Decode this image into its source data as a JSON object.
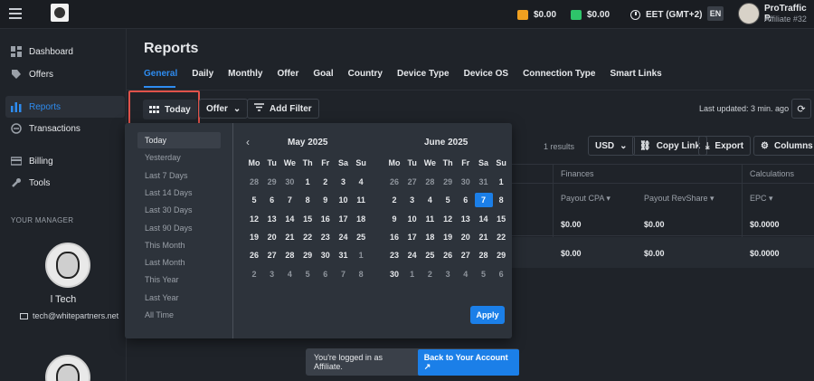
{
  "topbar": {
    "balance1": "$0.00",
    "balance2": "$0.00",
    "timezone": "EET (GMT+2)",
    "lang": "EN",
    "user_name": "ProTraffic P.",
    "user_role": "Affiliate #32",
    "balance1_color": "#f0a020",
    "balance2_color": "#2ec46a"
  },
  "sidebar": {
    "items": [
      {
        "label": "Dashboard",
        "icon": "dashboard-icon"
      },
      {
        "label": "Offers",
        "icon": "tag-icon"
      },
      {
        "label": "Reports",
        "icon": "bar-chart-icon"
      },
      {
        "label": "Transactions",
        "icon": "transactions-icon"
      },
      {
        "label": "Billing",
        "icon": "card-icon"
      },
      {
        "label": "Tools",
        "icon": "wrench-icon"
      }
    ],
    "manager_section": "YOUR MANAGER",
    "manager_name": "l Tech",
    "manager_email": "tech@whitepartners.net",
    "accent": "#2e8cf0"
  },
  "page": {
    "title": "Reports",
    "tabs": [
      "General",
      "Daily",
      "Monthly",
      "Offer",
      "Goal",
      "Country",
      "Device Type",
      "Device OS",
      "Connection Type",
      "Smart Links"
    ],
    "today_btn": "Today",
    "offer_btn": "Offer",
    "add_filter_btn": "Add Filter",
    "last_updated": "Last updated: 3 min. ago",
    "results": "1 results",
    "currency": "USD",
    "copy_link": "Copy Link",
    "export": "Export",
    "columns": "Columns"
  },
  "table": {
    "group_finances": "Finances",
    "group_calculations": "Calculations",
    "col_payout_cpa": "Payout CPA ▾",
    "col_payout_revshare": "Payout RevShare ▾",
    "col_epc": "EPC ▾",
    "rows": [
      {
        "payout_cpa": "$0.00",
        "payout_revshare": "$0.00",
        "epc": "$0.0000"
      },
      {
        "payout_cpa": "$0.00",
        "payout_revshare": "$0.00",
        "epc": "$0.0000"
      }
    ]
  },
  "datepicker": {
    "ranges": [
      "Today",
      "Yesterday",
      "Last 7 Days",
      "Last 14 Days",
      "Last 30 Days",
      "Last 90 Days",
      "This Month",
      "Last Month",
      "This Year",
      "Last Year",
      "All Time"
    ],
    "active_range": "Today",
    "weekdays": [
      "Mo",
      "Tu",
      "We",
      "Th",
      "Fr",
      "Sa",
      "Su"
    ],
    "months": [
      {
        "title": "May 2025",
        "weeks": [
          [
            "28",
            "29",
            "30",
            "1",
            "2",
            "3",
            "4"
          ],
          [
            "5",
            "6",
            "7",
            "8",
            "9",
            "10",
            "11"
          ],
          [
            "12",
            "13",
            "14",
            "15",
            "16",
            "17",
            "18"
          ],
          [
            "19",
            "20",
            "21",
            "22",
            "23",
            "24",
            "25"
          ],
          [
            "26",
            "27",
            "28",
            "29",
            "30",
            "31",
            "1"
          ],
          [
            "2",
            "3",
            "4",
            "5",
            "6",
            "7",
            "8"
          ]
        ]
      },
      {
        "title": "June 2025",
        "weeks": [
          [
            "26",
            "27",
            "28",
            "29",
            "30",
            "31",
            "1"
          ],
          [
            "2",
            "3",
            "4",
            "5",
            "6",
            "7",
            "8"
          ],
          [
            "9",
            "10",
            "11",
            "12",
            "13",
            "14",
            "15"
          ],
          [
            "16",
            "17",
            "18",
            "19",
            "20",
            "21",
            "22"
          ],
          [
            "23",
            "24",
            "25",
            "26",
            "27",
            "28",
            "29"
          ],
          [
            "30",
            "1",
            "2",
            "3",
            "4",
            "5",
            "6"
          ]
        ]
      }
    ],
    "selected_day": "7",
    "apply": "Apply"
  },
  "toast": {
    "text": "You're logged in as Affiliate.",
    "button": "Back to Your Account ↗"
  }
}
